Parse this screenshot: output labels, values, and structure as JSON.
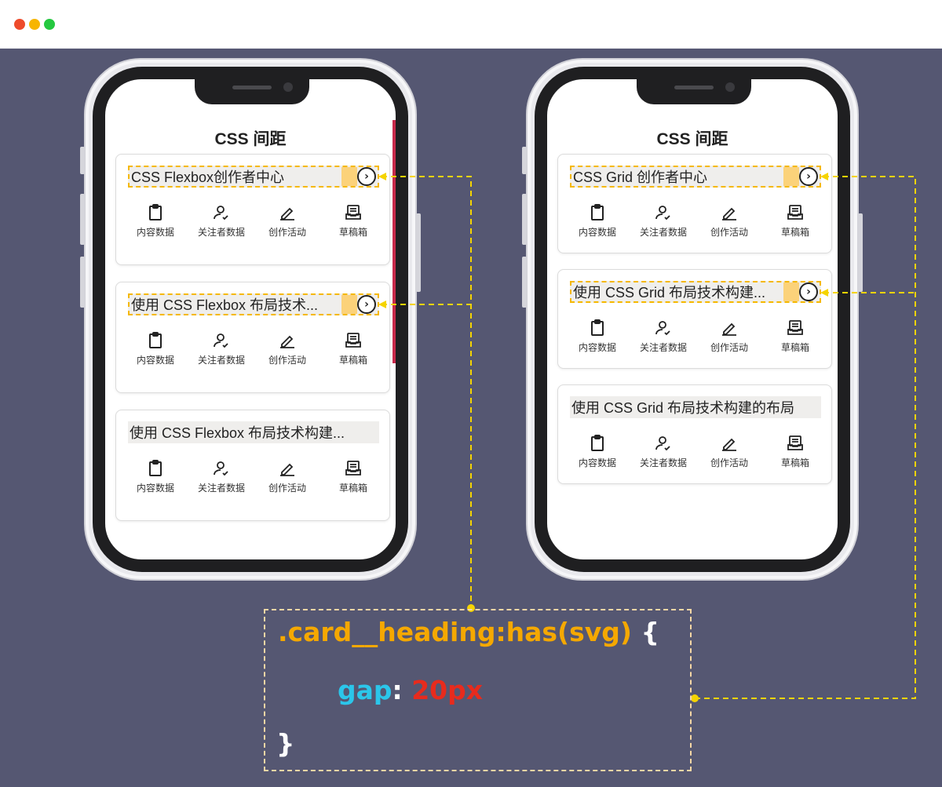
{
  "window": {
    "controls": [
      "close",
      "minimize",
      "maximize"
    ]
  },
  "phones": [
    {
      "title": "CSS 间距",
      "cards": [
        {
          "heading": "CSS Flexbox创作者中心",
          "has_arrow": true,
          "arrow_icon": "chevron-right-icon",
          "items": [
            {
              "icon": "clipboard-icon",
              "label": "内容数据"
            },
            {
              "icon": "user-check-icon",
              "label": "关注者数据"
            },
            {
              "icon": "pencil-icon",
              "label": "创作活动"
            },
            {
              "icon": "inbox-icon",
              "label": "草稿箱"
            }
          ]
        },
        {
          "heading": "使用 CSS Flexbox 布局技术...",
          "has_arrow": true,
          "arrow_icon": "chevron-right-icon",
          "items": [
            {
              "icon": "clipboard-icon",
              "label": "内容数据"
            },
            {
              "icon": "user-check-icon",
              "label": "关注者数据"
            },
            {
              "icon": "pencil-icon",
              "label": "创作活动"
            },
            {
              "icon": "inbox-icon",
              "label": "草稿箱"
            }
          ]
        },
        {
          "heading": "使用 CSS Flexbox 布局技术构建...",
          "has_arrow": false,
          "items": [
            {
              "icon": "clipboard-icon",
              "label": "内容数据"
            },
            {
              "icon": "user-check-icon",
              "label": "关注者数据"
            },
            {
              "icon": "pencil-icon",
              "label": "创作活动"
            },
            {
              "icon": "inbox-icon",
              "label": "草稿箱"
            }
          ]
        }
      ]
    },
    {
      "title": "CSS 间距",
      "cards": [
        {
          "heading": "CSS Grid 创作者中心",
          "has_arrow": true,
          "arrow_icon": "chevron-right-icon",
          "items": [
            {
              "icon": "clipboard-icon",
              "label": "内容数据"
            },
            {
              "icon": "user-check-icon",
              "label": "关注者数据"
            },
            {
              "icon": "pencil-icon",
              "label": "创作活动"
            },
            {
              "icon": "inbox-icon",
              "label": "草稿箱"
            }
          ]
        },
        {
          "heading": "使用 CSS Grid 布局技术构建...",
          "has_arrow": true,
          "arrow_icon": "chevron-right-icon",
          "items": [
            {
              "icon": "clipboard-icon",
              "label": "内容数据"
            },
            {
              "icon": "user-check-icon",
              "label": "关注者数据"
            },
            {
              "icon": "pencil-icon",
              "label": "创作活动"
            },
            {
              "icon": "inbox-icon",
              "label": "草稿箱"
            }
          ]
        },
        {
          "heading": "使用 CSS Grid 布局技术构建的布局",
          "has_arrow": false,
          "items": [
            {
              "icon": "clipboard-icon",
              "label": "内容数据"
            },
            {
              "icon": "user-check-icon",
              "label": "关注者数据"
            },
            {
              "icon": "pencil-icon",
              "label": "创作活动"
            },
            {
              "icon": "inbox-icon",
              "label": "草稿箱"
            }
          ]
        }
      ]
    }
  ],
  "code": {
    "selector": ".card__heading:has(svg)",
    "open_brace": "{",
    "property": "gap",
    "colon": ":",
    "value": "20px",
    "close_brace": "}"
  },
  "colors": {
    "background": "#555772",
    "highlight_border": "#f5b800",
    "gap_fill": "#fbd27a",
    "selector": "#f5a800",
    "property": "#2bc6ea",
    "value": "#e72b1d",
    "scroll_indicator": "#c8294b"
  }
}
